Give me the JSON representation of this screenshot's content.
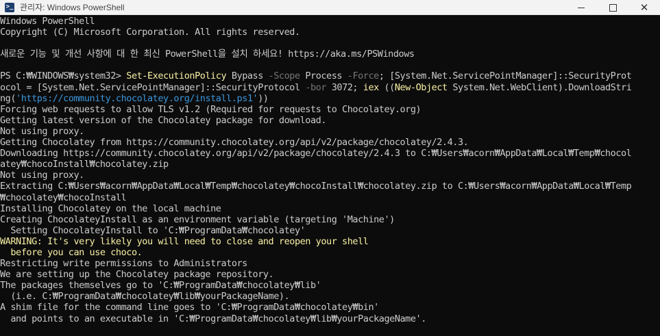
{
  "window": {
    "title": "관리자: Windows PowerShell",
    "icon": "powershell-icon",
    "controls": {
      "minimize": "minimize-icon",
      "maximize": "maximize-icon",
      "close": "✕"
    }
  },
  "console": {
    "line_01": "Windows PowerShell",
    "line_02": "Copyright (C) Microsoft Corporation. All rights reserved.",
    "line_03": "",
    "line_04": "새로운 기능 및 개선 사항에 대 한 최신 PowerShell을 설치 하세요! https://aka.ms/PSWindows",
    "line_05": "",
    "cmd": {
      "prompt": "PS C:₩WINDOWS₩system32> ",
      "t01": "Set-ExecutionPolicy",
      "t02": " Bypass ",
      "t03": "-Scope",
      "t04": " Process ",
      "t05": "-Force",
      "t06": "; [System.Net.ServicePointManager]::SecurityProt",
      "t07": "ocol = [System.Net.ServicePointManager]::SecurityProtocol ",
      "t08": "-bor",
      "t09": " 3072; ",
      "t10": "iex",
      "t11": " ((",
      "t12": "New-Object",
      "t13": " System.Net.WebClient).DownloadStri",
      "t14": "ng(",
      "t15": "'https://community.chocolatey.org/install.ps1'",
      "t16": "))"
    },
    "line_09": "Forcing web requests to allow TLS v1.2 (Required for requests to Chocolatey.org)",
    "line_10": "Getting latest version of the Chocolatey package for download.",
    "line_11": "Not using proxy.",
    "line_12": "Getting Chocolatey from https://community.chocolatey.org/api/v2/package/chocolatey/2.4.3.",
    "line_13": "Downloading https://community.chocolatey.org/api/v2/package/chocolatey/2.4.3 to C:₩Users₩acorn₩AppData₩Local₩Temp₩chocol",
    "line_14": "atey₩chocoInstall₩chocolatey.zip",
    "line_15": "Not using proxy.",
    "line_16": "Extracting C:₩Users₩acorn₩AppData₩Local₩Temp₩chocolatey₩chocoInstall₩chocolatey.zip to C:₩Users₩acorn₩AppData₩Local₩Temp",
    "line_17": "₩chocolatey₩chocoInstall",
    "line_18": "Installing Chocolatey on the local machine",
    "line_19": "Creating ChocolateyInstall as an environment variable (targeting 'Machine')",
    "line_20": "  Setting ChocolateyInstall to 'C:₩ProgramData₩chocolatey'",
    "line_21": "WARNING: It's very likely you will need to close and reopen your shell",
    "line_22": "  before you can use choco.",
    "line_23": "Restricting write permissions to Administrators",
    "line_24": "We are setting up the Chocolatey package repository.",
    "line_25": "The packages themselves go to 'C:₩ProgramData₩chocolatey₩lib'",
    "line_26": "  (i.e. C:₩ProgramData₩chocolatey₩lib₩yourPackageName).",
    "line_27": "A shim file for the command line goes to 'C:₩ProgramData₩chocolatey₩bin'",
    "line_28": "  and points to an executable in 'C:₩ProgramData₩chocolatey₩lib₩yourPackageName'."
  },
  "colors": {
    "background": "#0c0c0c",
    "text": "#cccccc",
    "cmdlet": "#f9f1a5",
    "parameter": "#767676",
    "string": "#3a96dd",
    "warning": "#f9f1a5"
  }
}
